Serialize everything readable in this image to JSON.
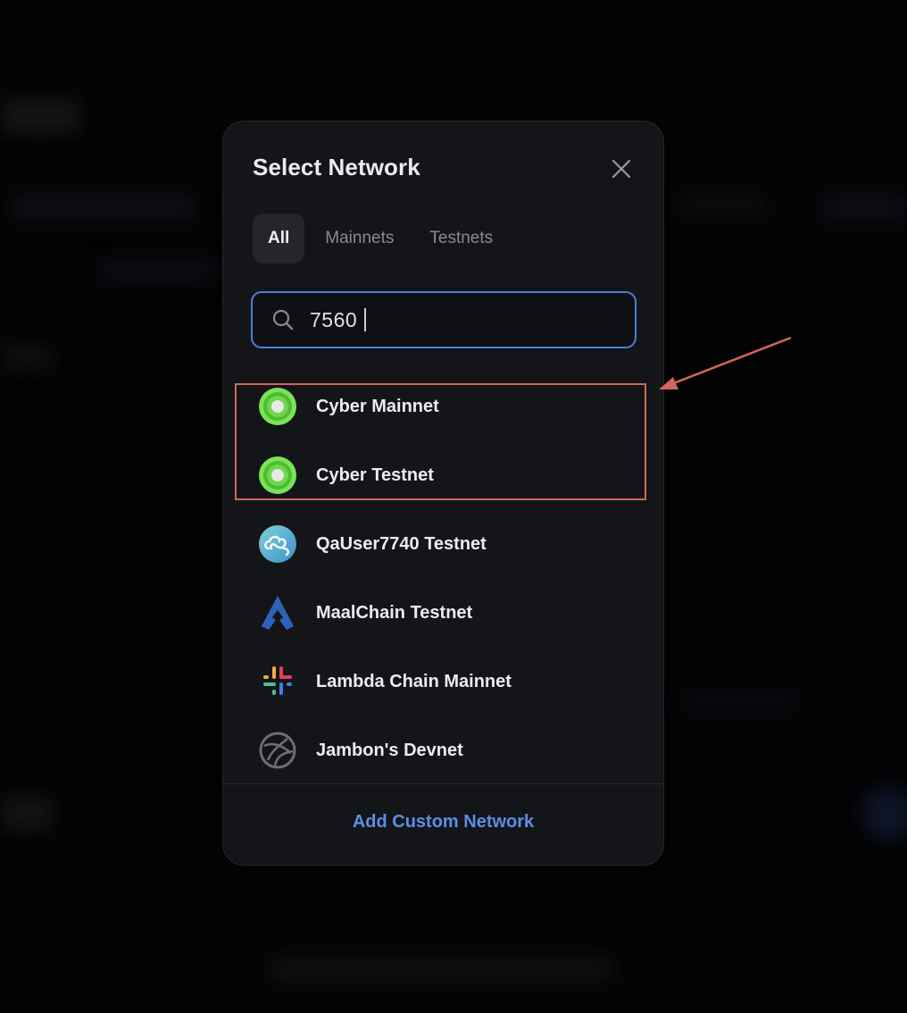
{
  "modal": {
    "title": "Select Network",
    "close_icon": "close-icon",
    "tabs": [
      {
        "label": "All",
        "active": true
      },
      {
        "label": "Mainnets",
        "active": false
      },
      {
        "label": "Testnets",
        "active": false
      }
    ],
    "search": {
      "icon": "search-icon",
      "value": "7560",
      "accent_color": "#4a7fd8"
    },
    "networks": [
      {
        "name": "Cyber Mainnet",
        "icon": "cyber-logo-icon",
        "highlighted": true
      },
      {
        "name": "Cyber Testnet",
        "icon": "cyber-logo-icon",
        "highlighted": true
      },
      {
        "name": "QaUser7740 Testnet",
        "icon": "cloud-logo-icon",
        "highlighted": false
      },
      {
        "name": "MaalChain Testnet",
        "icon": "maalchain-logo-icon",
        "highlighted": false
      },
      {
        "name": "Lambda Chain Mainnet",
        "icon": "lambda-logo-icon",
        "highlighted": false
      },
      {
        "name": "Jambon's Devnet",
        "icon": "globe-icon",
        "highlighted": false
      }
    ],
    "footer_link": "Add Custom Network",
    "link_color": "#5b8fe3"
  },
  "annotation": {
    "color": "#d1665a",
    "type": "highlight-box-with-arrow"
  }
}
